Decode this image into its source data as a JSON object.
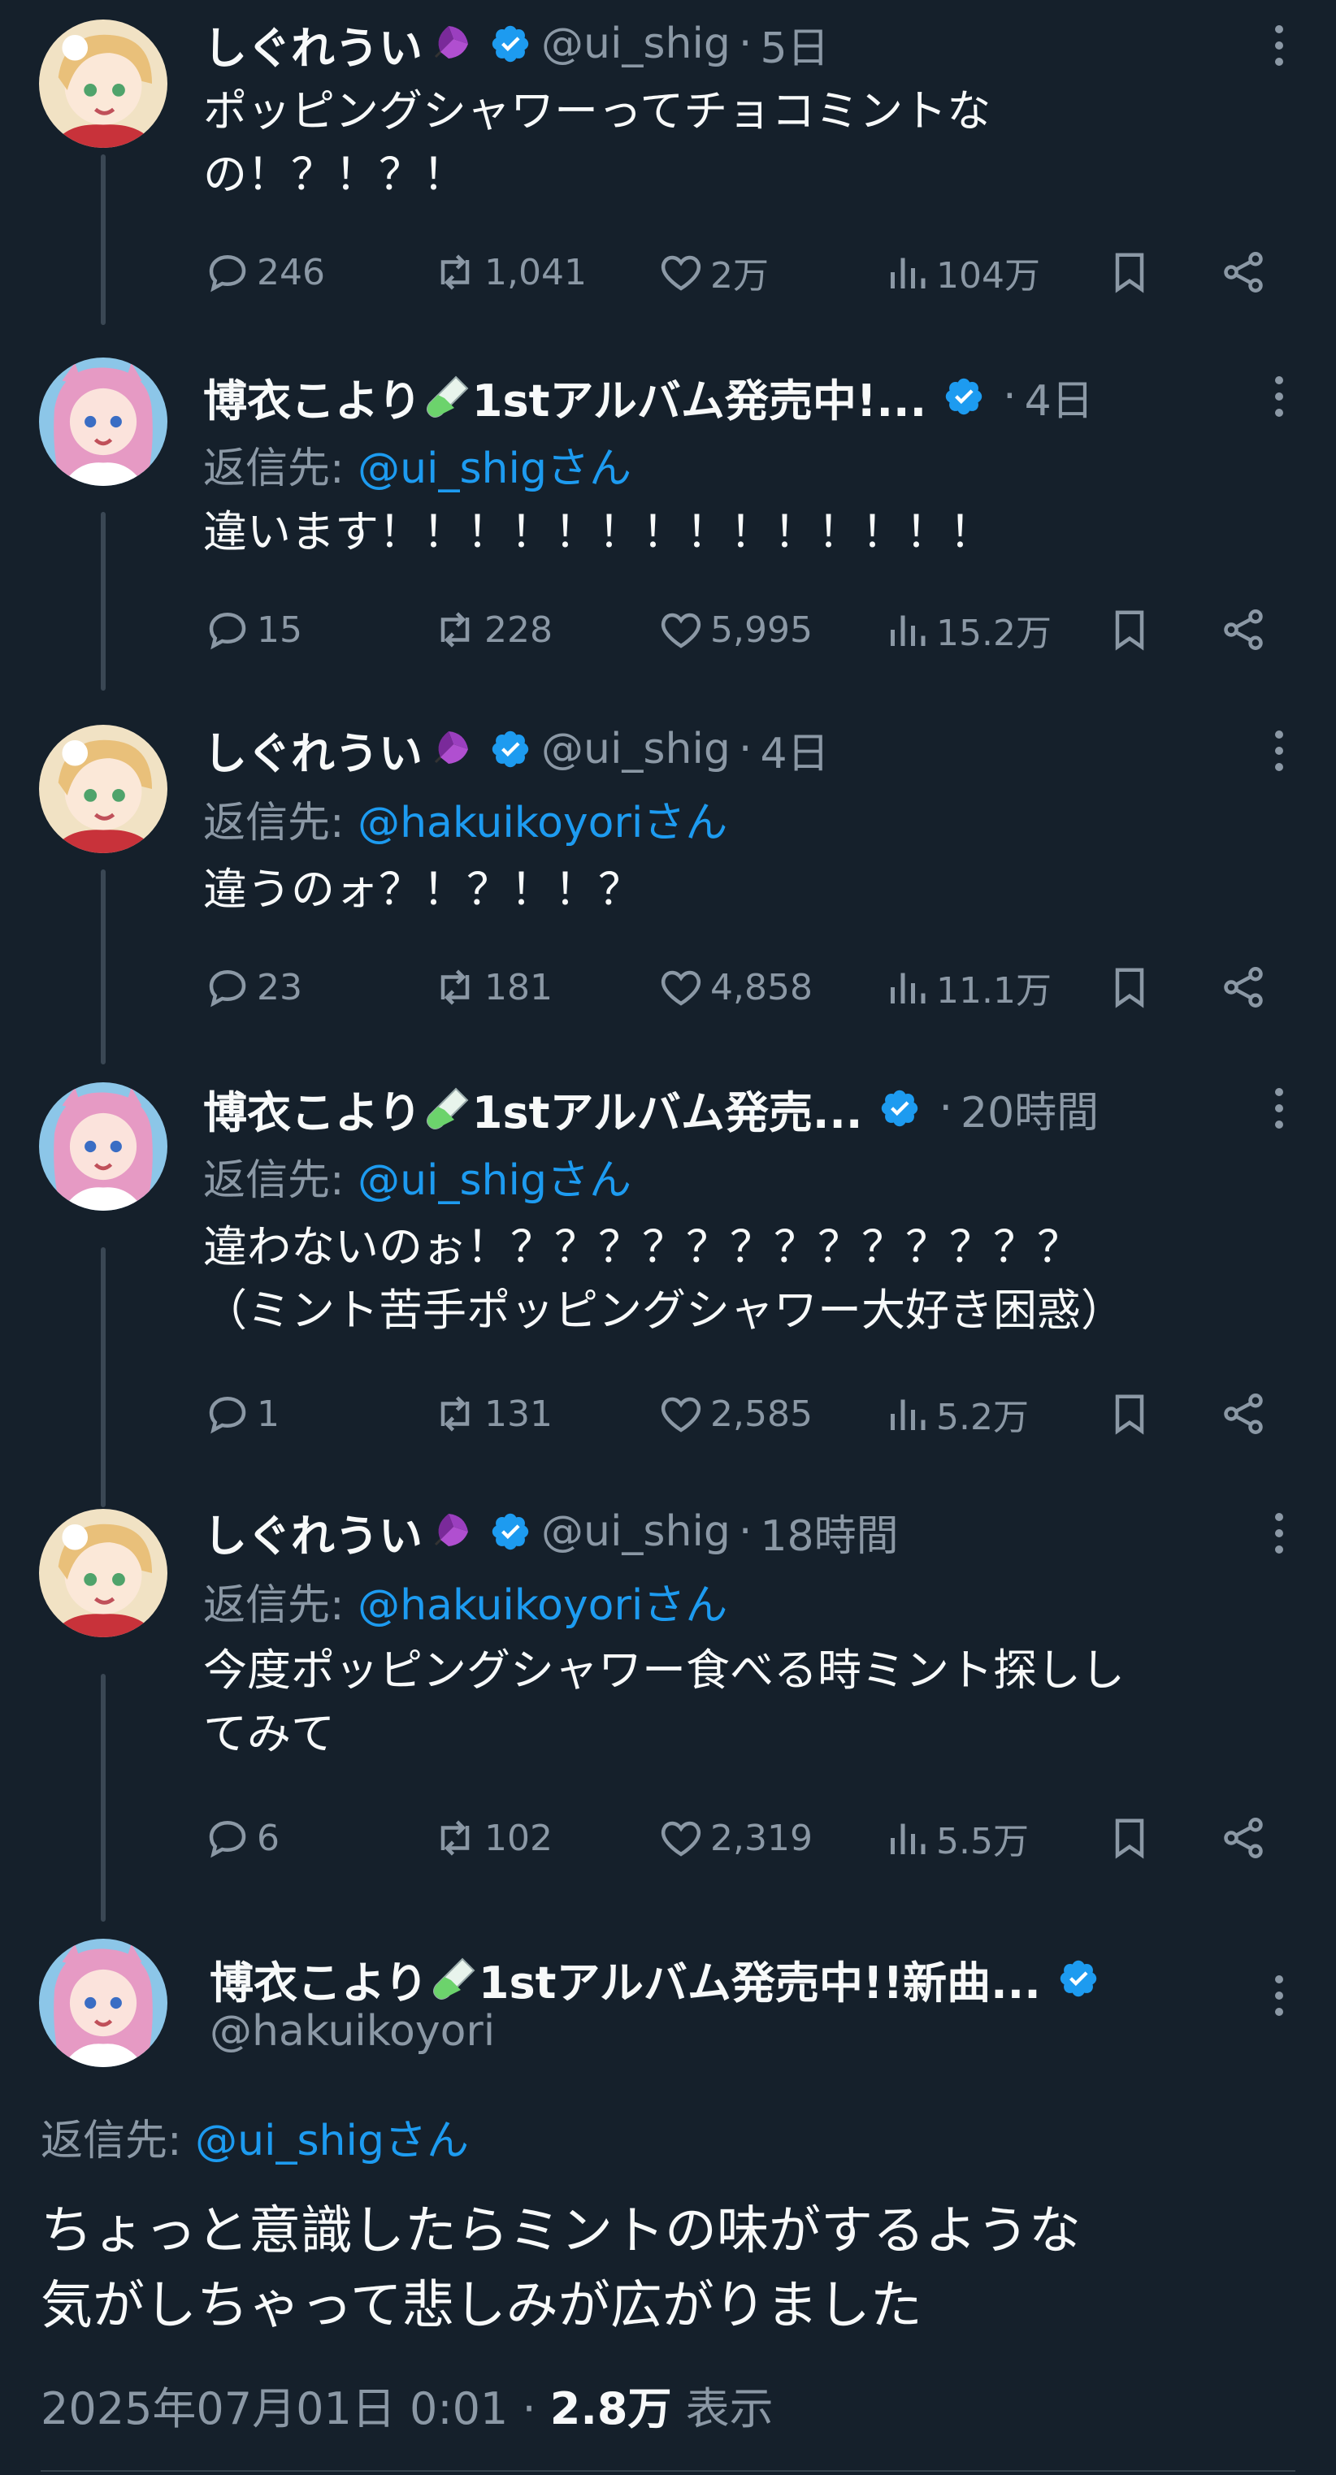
{
  "tweets": [
    {
      "name": "しぐれうい",
      "name_emoji": "umbrella-icon",
      "handle": "@ui_shig",
      "time": "5日",
      "reply_to_label": "",
      "reply_to_handle": "",
      "reply_to_suffix": "",
      "text": "ポッピングシャワーってチョコミントな\nの！？！？！",
      "replies": "246",
      "retweets": "1,041",
      "likes": "2万",
      "views": "104万"
    },
    {
      "name": "博衣こより",
      "name_emoji": "test-tube-icon",
      "name_suffix": "1stアルバム発売中!...",
      "handle": "",
      "time": "4日",
      "reply_to_label": "返信先: ",
      "reply_to_handle": "@ui_shig",
      "reply_to_suffix": "さん",
      "text": "違います！！！！！！！！！！！！！！",
      "replies": "15",
      "retweets": "228",
      "likes": "5,995",
      "views": "15.2万"
    },
    {
      "name": "しぐれうい",
      "name_emoji": "umbrella-icon",
      "handle": "@ui_shig",
      "time": "4日",
      "reply_to_label": "返信先: ",
      "reply_to_handle": "@hakuikoyori",
      "reply_to_suffix": "さん",
      "text": "違うのォ？！？！！？",
      "replies": "23",
      "retweets": "181",
      "likes": "4,858",
      "views": "11.1万"
    },
    {
      "name": "博衣こより",
      "name_emoji": "test-tube-icon",
      "name_suffix": "1stアルバム発売...",
      "handle": "",
      "time": "20時間",
      "reply_to_label": "返信先: ",
      "reply_to_handle": "@ui_shig",
      "reply_to_suffix": "さん",
      "text": "違わないのぉ！？？？？？？？？？？？？？\n（ミント苦手ポッピングシャワー大好き困惑）",
      "replies": "1",
      "retweets": "131",
      "likes": "2,585",
      "views": "5.2万"
    },
    {
      "name": "しぐれうい",
      "name_emoji": "umbrella-icon",
      "handle": "@ui_shig",
      "time": "18時間",
      "reply_to_label": "返信先: ",
      "reply_to_handle": "@hakuikoyori",
      "reply_to_suffix": "さん",
      "text": "今度ポッピングシャワー食べる時ミント探しし\nてみて",
      "replies": "6",
      "retweets": "102",
      "likes": "2,319",
      "views": "5.5万"
    }
  ],
  "main_tweet": {
    "name": "博衣こより",
    "name_suffix": "1stアルバム発売中!!新曲...",
    "handle": "@hakuikoyori",
    "reply_to_label": "返信先: ",
    "reply_to_handle": "@ui_shig",
    "reply_to_suffix": "さん",
    "text_line1": "ちょっと意識したらミントの味がするような",
    "text_line2": "気がしちゃって悲しみが広がりました",
    "datetime": "2025年07月01日 0:01",
    "separator": " · ",
    "views_count": "2.8万",
    "views_label": " 表示"
  },
  "dot_separator": "·",
  "colors": {
    "background": "#15202b",
    "text": "#f7f9f9",
    "secondary": "#8b98a5",
    "accent": "#1d9bf0",
    "thread_line": "#3a4754"
  }
}
